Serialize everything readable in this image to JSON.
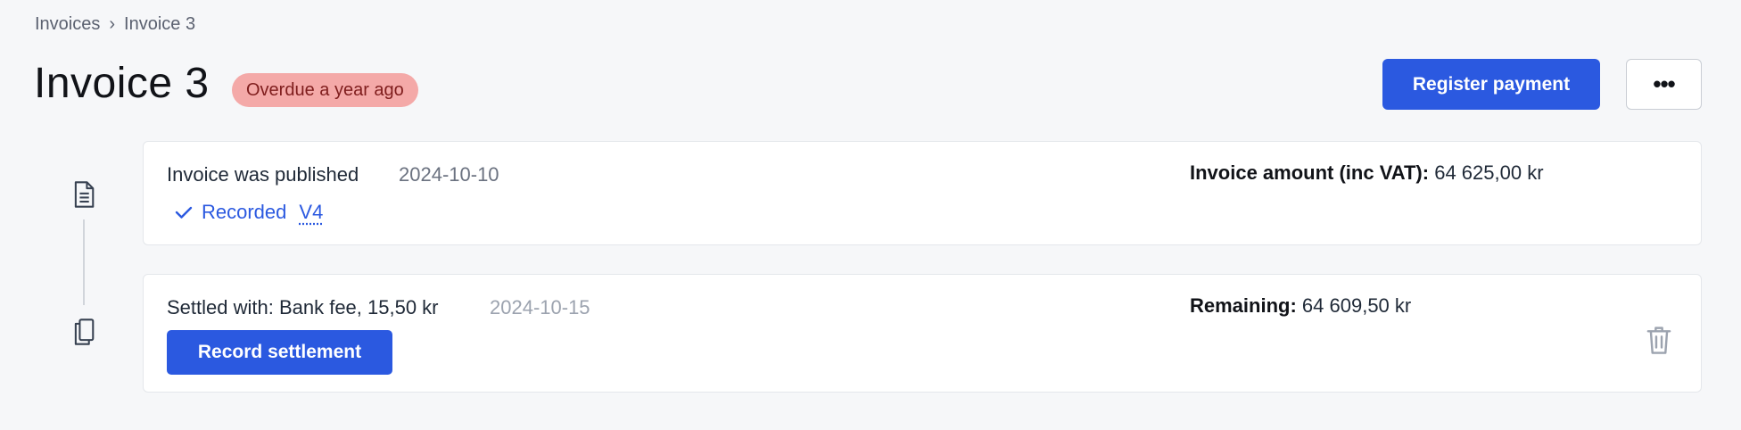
{
  "breadcrumb": {
    "items": [
      "Invoices",
      "Invoice 3"
    ],
    "separator": "›"
  },
  "header": {
    "title": "Invoice 3",
    "status_badge": "Overdue a year ago",
    "primary_action": "Register payment",
    "more_label": "•••"
  },
  "timeline": {
    "events": [
      {
        "icon": "document-icon",
        "text": "Invoice was published",
        "date": "2024-10-10",
        "recorded_label": "Recorded",
        "voucher": "V4",
        "amount_label": "Invoice amount (inc VAT):",
        "amount_value": "64 625,00 kr"
      },
      {
        "icon": "copy-icon",
        "text": "Settled with: Bank fee, 15,50 kr",
        "date": "2024-10-15",
        "action_label": "Record settlement",
        "amount_label": "Remaining:",
        "amount_value": "64 609,50 kr"
      }
    ]
  },
  "colors": {
    "primary": "#2b59e0",
    "badge_bg": "#f4a9a8",
    "badge_text": "#7f1d1d",
    "background": "#f6f7f9"
  }
}
